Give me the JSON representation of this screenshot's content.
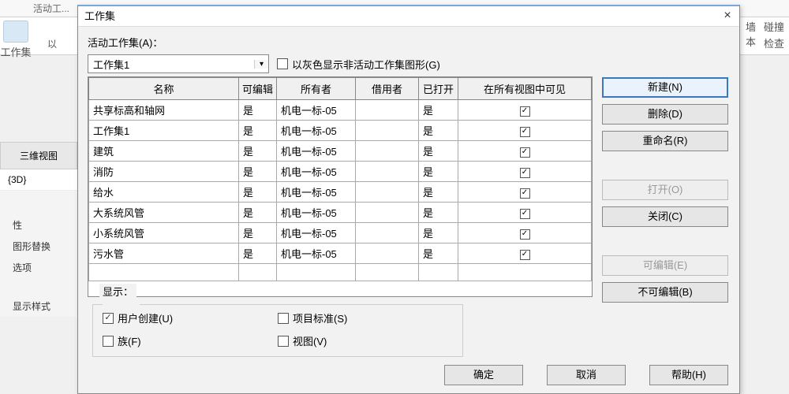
{
  "bg": {
    "tab": "活动工...",
    "btn1": "工作集",
    "btn2": "以",
    "right1_a": "墙",
    "right1_b": "本",
    "right2_a": "碰撞",
    "right2_b": "检查"
  },
  "side": {
    "head": "三维视图",
    "item1": "{3D}",
    "sub2": "性",
    "sub3": "图形替换",
    "sub4": "选项",
    "sub5": "显示样式"
  },
  "dialog": {
    "title": "工作集",
    "active_label": "活动工作集(A)：",
    "combo_value": "工作集1",
    "gray_label": "以灰色显示非活动工作集图形(G)"
  },
  "table": {
    "headers": {
      "name": "名称",
      "editable": "可编辑",
      "owner": "所有者",
      "borrower": "借用者",
      "opened": "已打开",
      "visible": "在所有视图中可见"
    },
    "rows": [
      {
        "name": "共享标高和轴网",
        "edit": "是",
        "owner": "机电一标-05",
        "borrow": "",
        "open": "是",
        "vis": true
      },
      {
        "name": "工作集1",
        "edit": "是",
        "owner": "机电一标-05",
        "borrow": "",
        "open": "是",
        "vis": true
      },
      {
        "name": "建筑",
        "edit": "是",
        "owner": "机电一标-05",
        "borrow": "",
        "open": "是",
        "vis": true
      },
      {
        "name": "消防",
        "edit": "是",
        "owner": "机电一标-05",
        "borrow": "",
        "open": "是",
        "vis": true
      },
      {
        "name": "给水",
        "edit": "是",
        "owner": "机电一标-05",
        "borrow": "",
        "open": "是",
        "vis": true
      },
      {
        "name": "大系统风管",
        "edit": "是",
        "owner": "机电一标-05",
        "borrow": "",
        "open": "是",
        "vis": true
      },
      {
        "name": "小系统风管",
        "edit": "是",
        "owner": "机电一标-05",
        "borrow": "",
        "open": "是",
        "vis": true
      },
      {
        "name": "污水管",
        "edit": "是",
        "owner": "机电一标-05",
        "borrow": "",
        "open": "是",
        "vis": true
      }
    ]
  },
  "buttons": {
    "new": "新建(N)",
    "delete": "删除(D)",
    "rename": "重命名(R)",
    "open": "打开(O)",
    "close": "关闭(C)",
    "editable": "可编辑(E)",
    "noneditable": "不可编辑(B)"
  },
  "show": {
    "legend": "显示：",
    "user": "用户创建(U)",
    "proj": "项目标准(S)",
    "family": "族(F)",
    "view": "视图(V)"
  },
  "footer": {
    "ok": "确定",
    "cancel": "取消",
    "help": "帮助(H)"
  }
}
